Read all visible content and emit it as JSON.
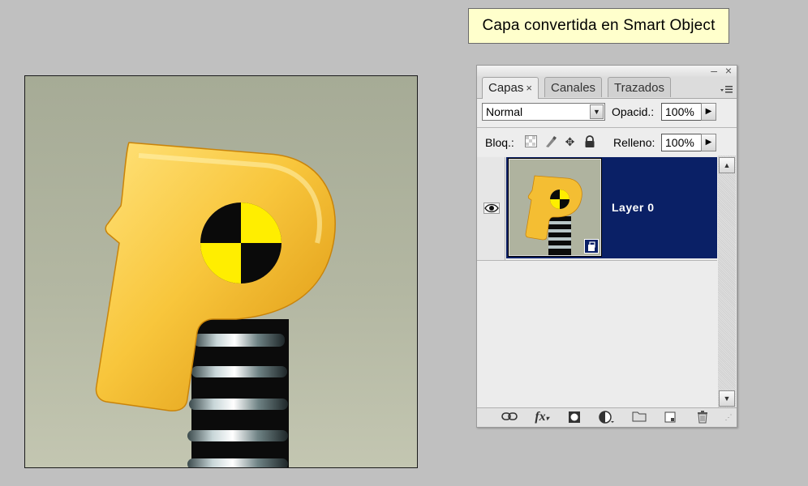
{
  "callout": {
    "text": "Capa convertida en Smart Object"
  },
  "panel": {
    "window_buttons": {
      "minimize": "–",
      "close": "×"
    },
    "tabs": [
      {
        "label": "Capas",
        "active": true,
        "close": "×"
      },
      {
        "label": "Canales",
        "active": false
      },
      {
        "label": "Trazados",
        "active": false
      }
    ],
    "menu_icon": "panel-menu-icon",
    "blend_mode": {
      "value": "Normal"
    },
    "opacity": {
      "label": "Opacid.:",
      "value": "100%"
    },
    "lock": {
      "label": "Bloq.:",
      "icons": [
        "lock-transparency-icon",
        "lock-image-icon",
        "lock-position-icon",
        "lock-all-icon"
      ]
    },
    "fill": {
      "label": "Relleno:",
      "value": "100%"
    },
    "layers": [
      {
        "name": "Layer 0",
        "visible": true,
        "selected": true,
        "smart_object": true
      }
    ],
    "footer_icons": [
      "link-layers-icon",
      "fx-icon",
      "add-mask-icon",
      "adjustment-layer-icon",
      "new-group-icon",
      "new-layer-icon",
      "trash-icon"
    ],
    "footer_labels": {
      "fx": "fx"
    }
  },
  "colors": {
    "selection": "#0a2066",
    "callout_bg": "#ffffcc",
    "letter_yellow": "#f7c235",
    "target_yellow": "#ffee00"
  }
}
